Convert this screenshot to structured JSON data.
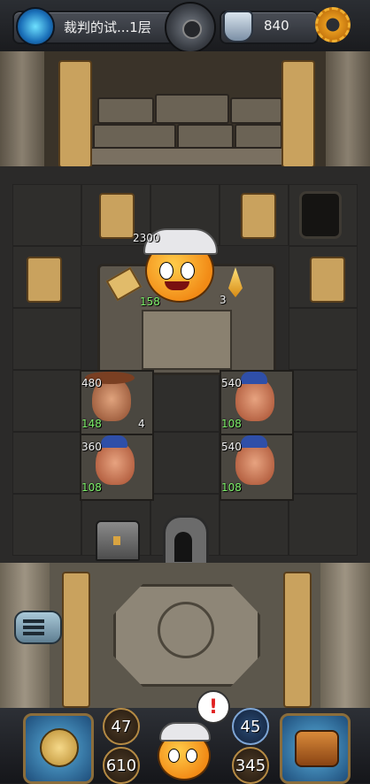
{
  "header": {
    "level_title": "裁判的试...1层",
    "crystals": "840",
    "portal_icon": "portal-icon",
    "center_icon": "compass-medallion-icon",
    "crystal_icon": "crystal-shield-icon",
    "settings_icon": "gear-icon"
  },
  "board": {
    "boss": {
      "hp": "2300",
      "attack": "158",
      "defense": "3"
    },
    "enemies": [
      {
        "hp": "480",
        "attack": "148",
        "defense": "4"
      },
      {
        "hp": "540",
        "attack": "108"
      },
      {
        "hp": "360",
        "attack": "108"
      },
      {
        "hp": "540",
        "attack": "108"
      }
    ]
  },
  "hero": {
    "attack": "47",
    "hp": "610",
    "defense": "45",
    "gold": "345",
    "alert": "!"
  },
  "colors": {
    "accent": "#f0a020",
    "attack_green": "#7df06a",
    "gold_frame": "#b48a44"
  }
}
